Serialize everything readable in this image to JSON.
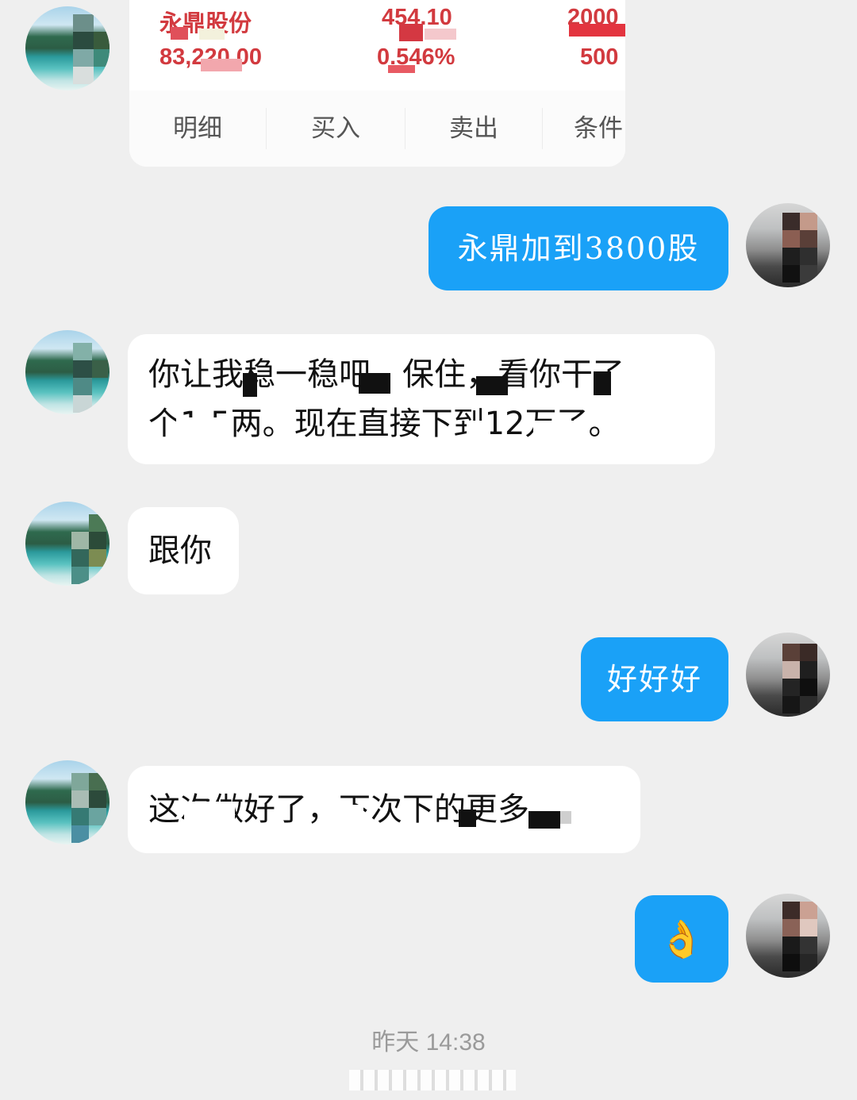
{
  "trade_card": {
    "stock_name": "永鼎股份",
    "amount": "83,220.00",
    "price": "454.10",
    "change_pct": "0.546%",
    "shares_total": "2000",
    "shares_available": "500",
    "actions": [
      "明细",
      "买入",
      "卖出",
      "条件"
    ]
  },
  "messages": [
    {
      "side": "out",
      "lines": [
        "永鼎加到3800股"
      ]
    },
    {
      "side": "in",
      "lines": [
        "你让我稳一稳吧，保住，看你干了",
        "个1.5两。现在直接下到12万了。"
      ]
    },
    {
      "side": "in",
      "lines": [
        "跟你"
      ]
    },
    {
      "side": "out",
      "lines": [
        "好好好"
      ]
    },
    {
      "side": "in",
      "lines": [
        "这次做好了，下次下的更多。"
      ]
    },
    {
      "side": "out",
      "lines": [
        "👌"
      ]
    }
  ],
  "timestamp": "昨天 14:38",
  "colors": {
    "background": "#efefef",
    "outgoing_bubble": "#1aa1f7",
    "incoming_bubble": "#ffffff",
    "stock_red": "#d23a3f"
  }
}
